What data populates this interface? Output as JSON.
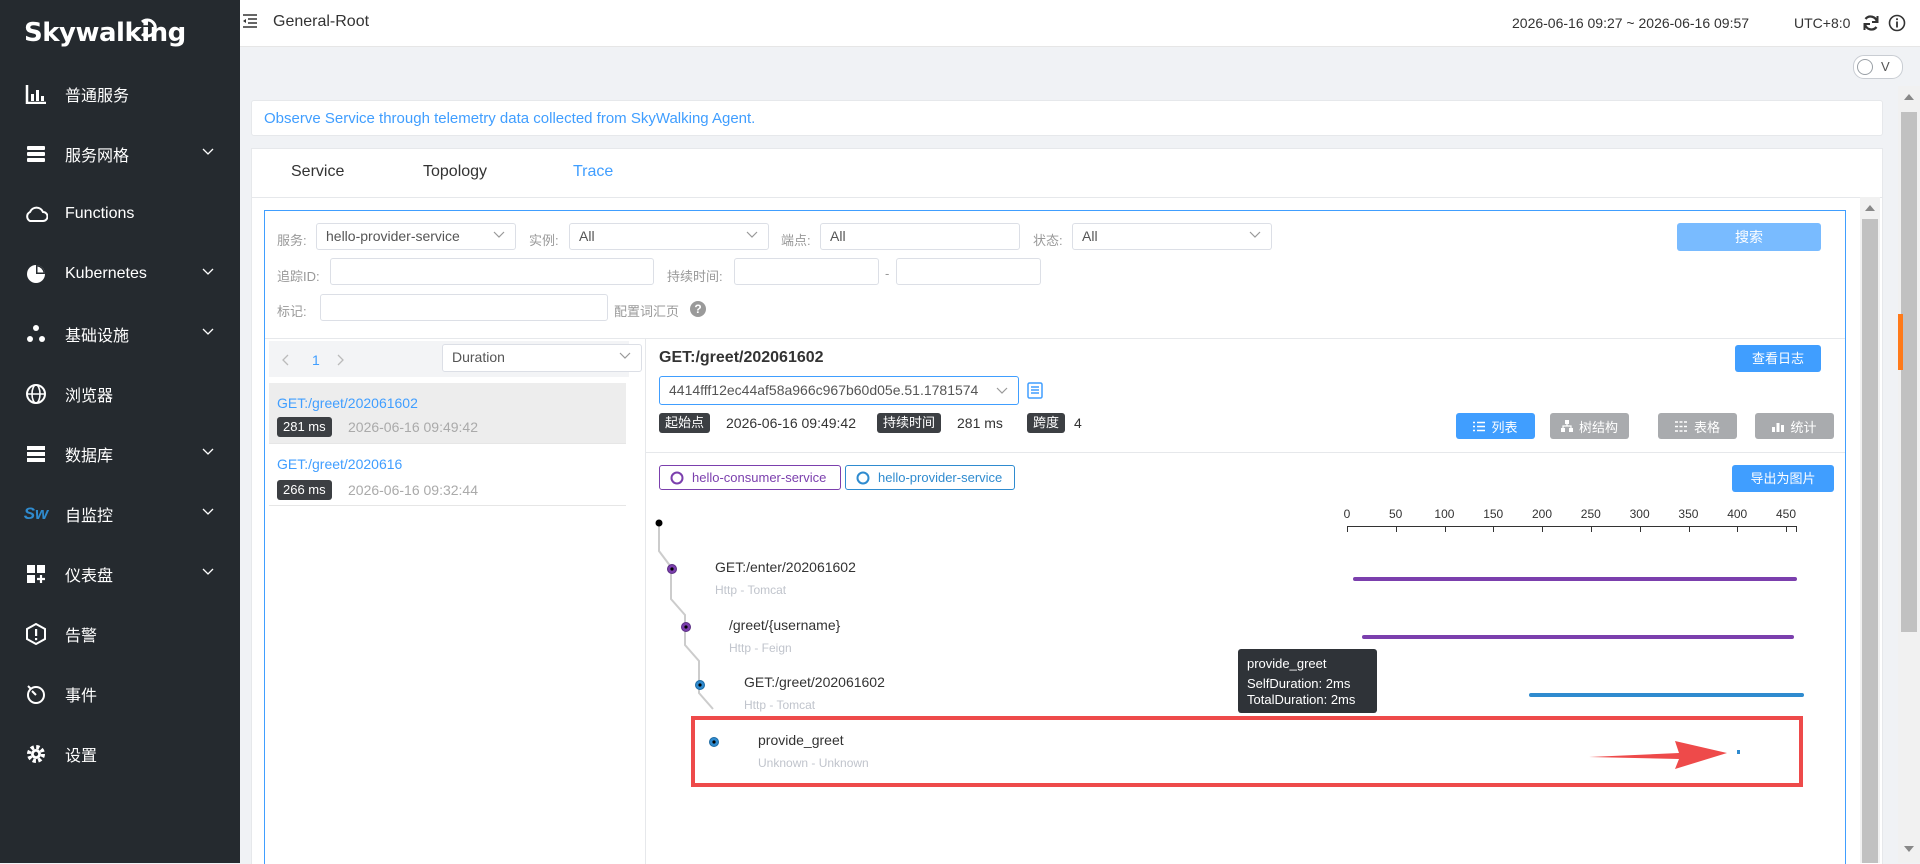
{
  "sidebar": {
    "logo": "Skywalking",
    "items": [
      {
        "label": "普通服务",
        "icon": "bar-chart-icon",
        "chevron": false
      },
      {
        "label": "服务网格",
        "icon": "layers-icon",
        "chevron": true
      },
      {
        "label": "Functions",
        "icon": "cloud-icon",
        "chevron": false
      },
      {
        "label": "Kubernetes",
        "icon": "pie-chart-icon",
        "chevron": true
      },
      {
        "label": "基础设施",
        "icon": "nodes-icon",
        "chevron": true
      },
      {
        "label": "浏览器",
        "icon": "globe-icon",
        "chevron": false
      },
      {
        "label": "数据库",
        "icon": "database-icon",
        "chevron": true
      },
      {
        "label": "自监控",
        "icon": "sw-logo-icon",
        "chevron": true
      },
      {
        "label": "仪表盘",
        "icon": "dashboard-icon",
        "chevron": true
      },
      {
        "label": "告警",
        "icon": "alert-icon",
        "chevron": false
      },
      {
        "label": "事件",
        "icon": "timer-icon",
        "chevron": false
      },
      {
        "label": "设置",
        "icon": "gear-icon",
        "chevron": false
      }
    ]
  },
  "header": {
    "title": "General-Root",
    "time_range": "2026-06-16 09:27 ~ 2026-06-16 09:57",
    "timezone": "UTC+8:0",
    "toggle_label": "V"
  },
  "banner": "Observe Service through telemetry data collected from SkyWalking Agent.",
  "tabs": [
    {
      "label": "Service",
      "active": false
    },
    {
      "label": "Topology",
      "active": false
    },
    {
      "label": "Trace",
      "active": true
    }
  ],
  "filters": {
    "service_label": "服务:",
    "service_value": "hello-provider-service",
    "instance_label": "实例:",
    "instance_value": "All",
    "endpoint_label": "端点:",
    "endpoint_value": "All",
    "status_label": "状态:",
    "status_value": "All",
    "search_button": "搜索",
    "trace_id_label": "追踪ID:",
    "duration_label": "持续时间:",
    "duration_sep": "-",
    "tags_label": "标记:",
    "tags_link": "配置词汇页",
    "help_icon": "?"
  },
  "list": {
    "page": "1",
    "sort": "Duration",
    "items": [
      {
        "name": "GET:/greet/202061602",
        "duration": "281 ms",
        "time": "2026-06-16 09:49:42"
      },
      {
        "name": "GET:/greet/2020616",
        "duration": "266 ms",
        "time": "2026-06-16 09:32:44"
      }
    ]
  },
  "detail": {
    "title": "GET:/greet/202061602",
    "logs_button": "查看日志",
    "trace_id": "4414fff12ec44af58a966c967b60d05e.51.1781574",
    "start_label": "起始点",
    "start_value": "2026-06-16 09:49:42",
    "duration_label": "持续时间",
    "duration_value": "281 ms",
    "spans_label": "跨度",
    "spans_value": "4",
    "views": [
      "列表",
      "树结构",
      "表格",
      "统计"
    ],
    "services": [
      {
        "name": "hello-consumer-service",
        "color": "#7b3fad"
      },
      {
        "name": "hello-provider-service",
        "color": "#2f8bcf"
      }
    ],
    "export_button": "导出为图片",
    "axis_ticks": [
      "0",
      "50",
      "100",
      "150",
      "200",
      "250",
      "300",
      "350",
      "400",
      "450"
    ],
    "spans": [
      {
        "title": "GET:/enter/202061602",
        "sub": "Http - Tomcat",
        "color": "#7b3fad"
      },
      {
        "title": "/greet/{username}",
        "sub": "Http - Feign",
        "color": "#7b3fad"
      },
      {
        "title": "GET:/greet/202061602",
        "sub": "Http - Tomcat",
        "color": "#2f8bcf"
      },
      {
        "title": "provide_greet",
        "sub": "Unknown - Unknown",
        "color": "#2f8bcf"
      }
    ],
    "tooltip": {
      "title": "provide_greet",
      "self": "SelfDuration: 2ms",
      "total": "TotalDuration: 2ms"
    }
  },
  "colors": {
    "accent": "#409eff",
    "highlight": "#ee4a4a",
    "sidebar": "#252a2f"
  }
}
